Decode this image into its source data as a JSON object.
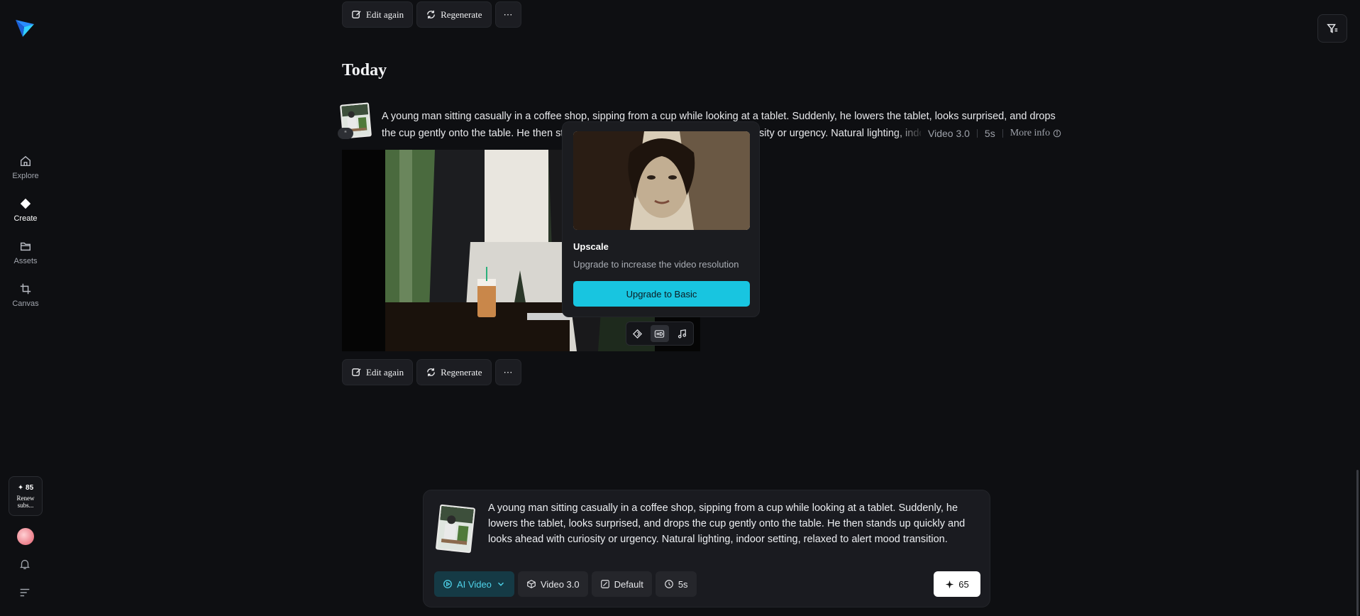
{
  "sidebar": {
    "logo_icon": "paper-plane-logo",
    "items": [
      {
        "label": "Explore",
        "icon": "home-icon",
        "active": false
      },
      {
        "label": "Create",
        "icon": "diamond-icon",
        "active": true
      },
      {
        "label": "Assets",
        "icon": "folder-icon",
        "active": false
      },
      {
        "label": "Canvas",
        "icon": "crop-icon",
        "active": false
      }
    ],
    "credits": "✦ 85",
    "renew_label": "Renew subs..."
  },
  "top_actions": {
    "edit_again": "Edit again",
    "regenerate": "Regenerate",
    "more": "⋯"
  },
  "section": {
    "title": "Today"
  },
  "entry": {
    "prompt_line1": "A young man sitting casually in a coffee shop, sipping from a cup while looking at a tablet. Suddenly, he lowers the tablet, looks surprised, and drops",
    "prompt_line2": "the cup gently onto the table. He then stands up quickly and looks ahead with curiosity or urgency. Natural lighting, indoor setting",
    "thumb_badge": "“",
    "model": "Video 3.0",
    "duration": "5s",
    "more_info": "More info"
  },
  "popover": {
    "title": "Upscale",
    "subtitle": "Upgrade to increase the video resolution",
    "button": "Upgrade to Basic"
  },
  "bottom_actions": {
    "edit_again": "Edit again",
    "regenerate": "Regenerate",
    "more": "⋯"
  },
  "composer": {
    "text": "A young man sitting casually in a coffee shop, sipping from a cup while looking at a tablet. Suddenly, he lowers the tablet, looks surprised, and drops the cup gently onto the table. He then stands up quickly and looks ahead with curiosity or urgency. Natural lighting, indoor setting, relaxed to alert mood transition.",
    "mode": "AI Video",
    "model": "Video 3.0",
    "ratio": "Default",
    "duration": "5s",
    "cost": "65"
  },
  "colors": {
    "accent": "#18c5e0",
    "background": "#0e0f12"
  }
}
